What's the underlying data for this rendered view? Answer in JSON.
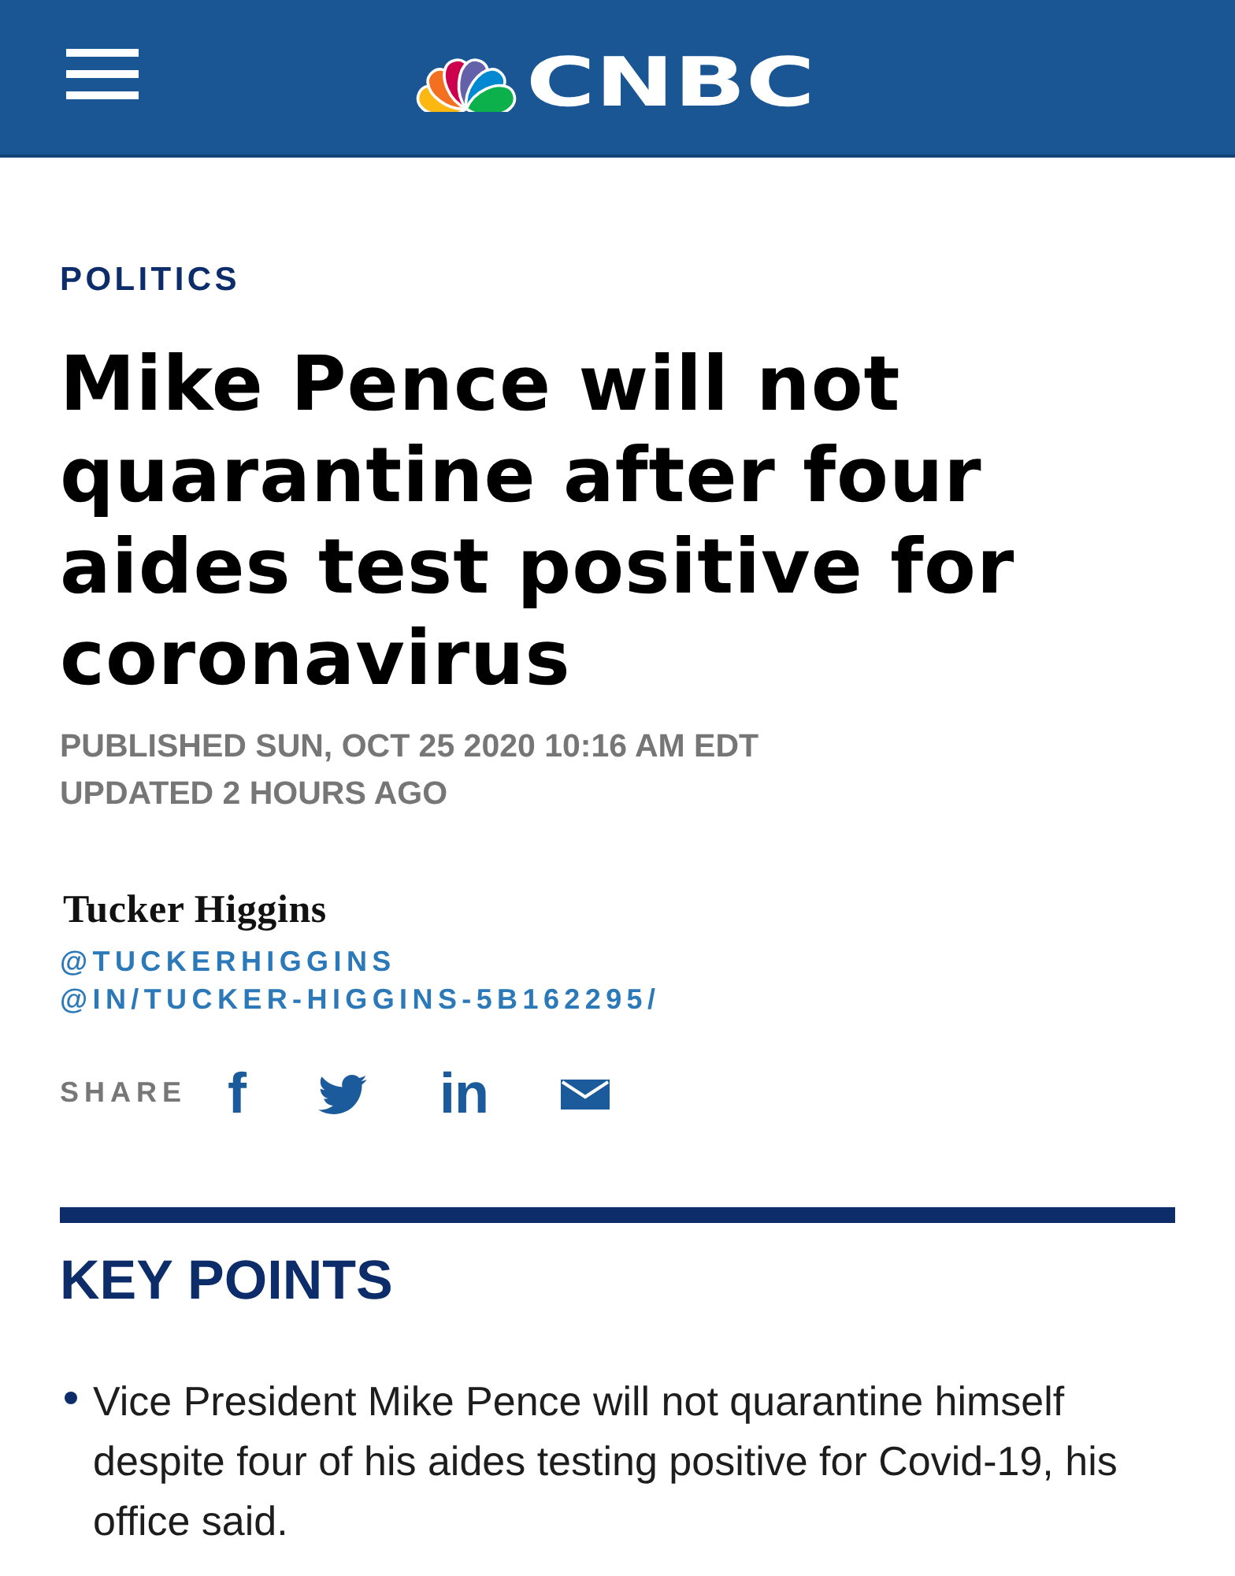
{
  "header": {
    "logo_text": "CNBC"
  },
  "article": {
    "section": "POLITICS",
    "headline": "Mike Pence will not quarantine after four aides test positive for coronavirus",
    "published": "PUBLISHED SUN, OCT 25 2020 10:16 AM EDT",
    "updated": "UPDATED 2 HOURS AGO"
  },
  "author": {
    "name": "Tucker Higgins",
    "handles": [
      "@TUCKERHIGGINS",
      "@IN/TUCKER-HIGGINS-5B162295/"
    ]
  },
  "share": {
    "label": "SHARE",
    "buttons": [
      {
        "kind": "facebook",
        "label": "f"
      },
      {
        "kind": "twitter"
      },
      {
        "kind": "linkedin",
        "label": "in"
      },
      {
        "kind": "email"
      }
    ]
  },
  "key_points": {
    "title": "KEY POINTS",
    "items": [
      "Vice President Mike Pence will not quarantine himself despite four of his aides testing positive for Covid-19, his office said."
    ]
  }
}
